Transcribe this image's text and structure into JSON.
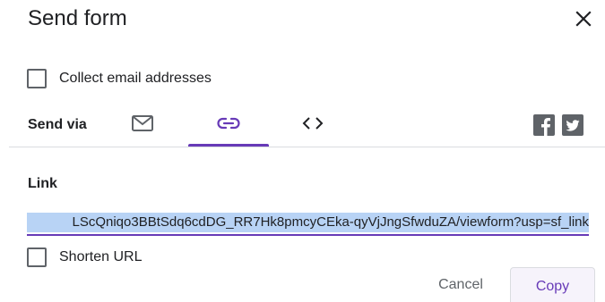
{
  "dialog": {
    "title": "Send form"
  },
  "options": {
    "collect_email_label": "Collect email addresses",
    "collect_email_checked": false,
    "shorten_url_label": "Shorten URL",
    "shorten_url_checked": false
  },
  "send_via": {
    "label": "Send via",
    "tabs": [
      {
        "name": "email",
        "icon": "email-icon",
        "selected": false
      },
      {
        "name": "link",
        "icon": "link-icon",
        "selected": true
      },
      {
        "name": "embed",
        "icon": "code-icon",
        "selected": false
      }
    ],
    "social": [
      {
        "name": "facebook",
        "icon": "facebook-icon"
      },
      {
        "name": "twitter",
        "icon": "twitter-icon"
      }
    ]
  },
  "link_section": {
    "label": "Link",
    "value": "LScQniqo3BBtSdq6cdDG_RR7Hk8pmcyCEka-qyVjJngSfwduZA/viewform?usp=sf_link"
  },
  "actions": {
    "cancel_label": "Cancel",
    "copy_label": "Copy"
  },
  "colors": {
    "accent": "#673ab7",
    "selection": "#b8d3f5",
    "icon_gray": "#5f6368",
    "divider": "#dadce0"
  }
}
